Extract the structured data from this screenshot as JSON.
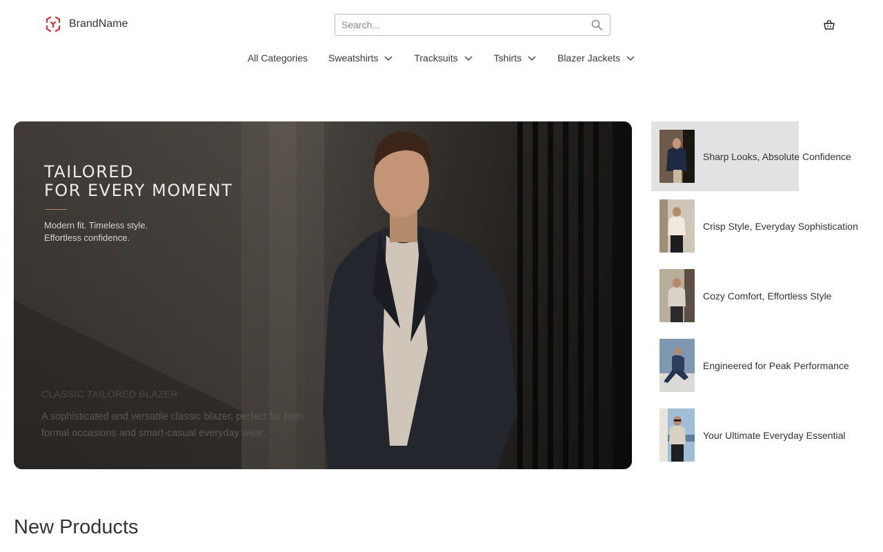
{
  "header": {
    "brand_name": "BrandName",
    "search_placeholder": "Search...",
    "icons": {
      "logo": "brand-logo-icon",
      "search": "search-icon",
      "cart": "basket-icon"
    },
    "accent_color": "#d32f2f"
  },
  "nav": {
    "items": [
      {
        "label": "All Categories",
        "has_dropdown": false
      },
      {
        "label": "Sweatshirts",
        "has_dropdown": true
      },
      {
        "label": "Tracksuits",
        "has_dropdown": true
      },
      {
        "label": "Tshirts",
        "has_dropdown": true
      },
      {
        "label": "Blazer Jackets",
        "has_dropdown": true
      }
    ]
  },
  "hero": {
    "title": "TAILORED\nFOR EVERY MOMENT",
    "subtitle": "Modern fit. Timeless style.\nEffortless confidence.",
    "product_name": "CLASSIC TAILORED BLAZER",
    "product_description": "A sophisticated and versatile classic blazer, perfect for both formal occasions and smart-casual everyday wear."
  },
  "side_list": {
    "items": [
      {
        "label": "Sharp Looks, Absolute Confidence",
        "active": true
      },
      {
        "label": "Crisp Style, Everyday Sophistication",
        "active": false
      },
      {
        "label": "Cozy Comfort, Effortless Style",
        "active": false
      },
      {
        "label": "Engineered for Peak Performance",
        "active": false
      },
      {
        "label": "Your Ultimate Everyday Essential",
        "active": false
      }
    ]
  },
  "new_products": {
    "title": "New Products"
  }
}
